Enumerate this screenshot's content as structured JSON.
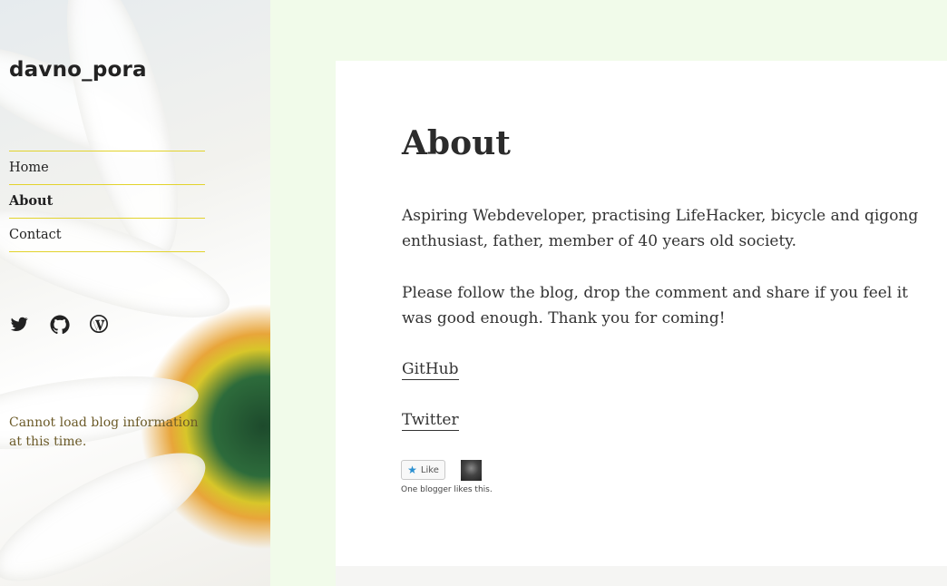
{
  "site": {
    "title": "davno_pora"
  },
  "nav": {
    "items": [
      {
        "label": "Home"
      },
      {
        "label": "About"
      },
      {
        "label": "Contact"
      }
    ]
  },
  "social": {
    "icons": [
      "twitter-icon",
      "github-icon",
      "wordpress-icon"
    ]
  },
  "sidebar": {
    "note": "Cannot load blog information at this time."
  },
  "page": {
    "title": "About",
    "paragraphs": [
      "Aspiring Webdeveloper, practising LifeHacker, bicycle and qigong enthusiast, father, member of 40 years old society.",
      "Please follow the blog, drop the comment and share if you feel it was good enough. Thank you for coming!"
    ],
    "links": [
      {
        "label": "GitHub"
      },
      {
        "label": "Twitter"
      }
    ]
  },
  "likes": {
    "button_label": "Like",
    "summary": "One blogger likes this."
  },
  "colors": {
    "background": "#f1fbea",
    "nav_border": "#e2d32c",
    "like_star": "#2a8fd0"
  }
}
